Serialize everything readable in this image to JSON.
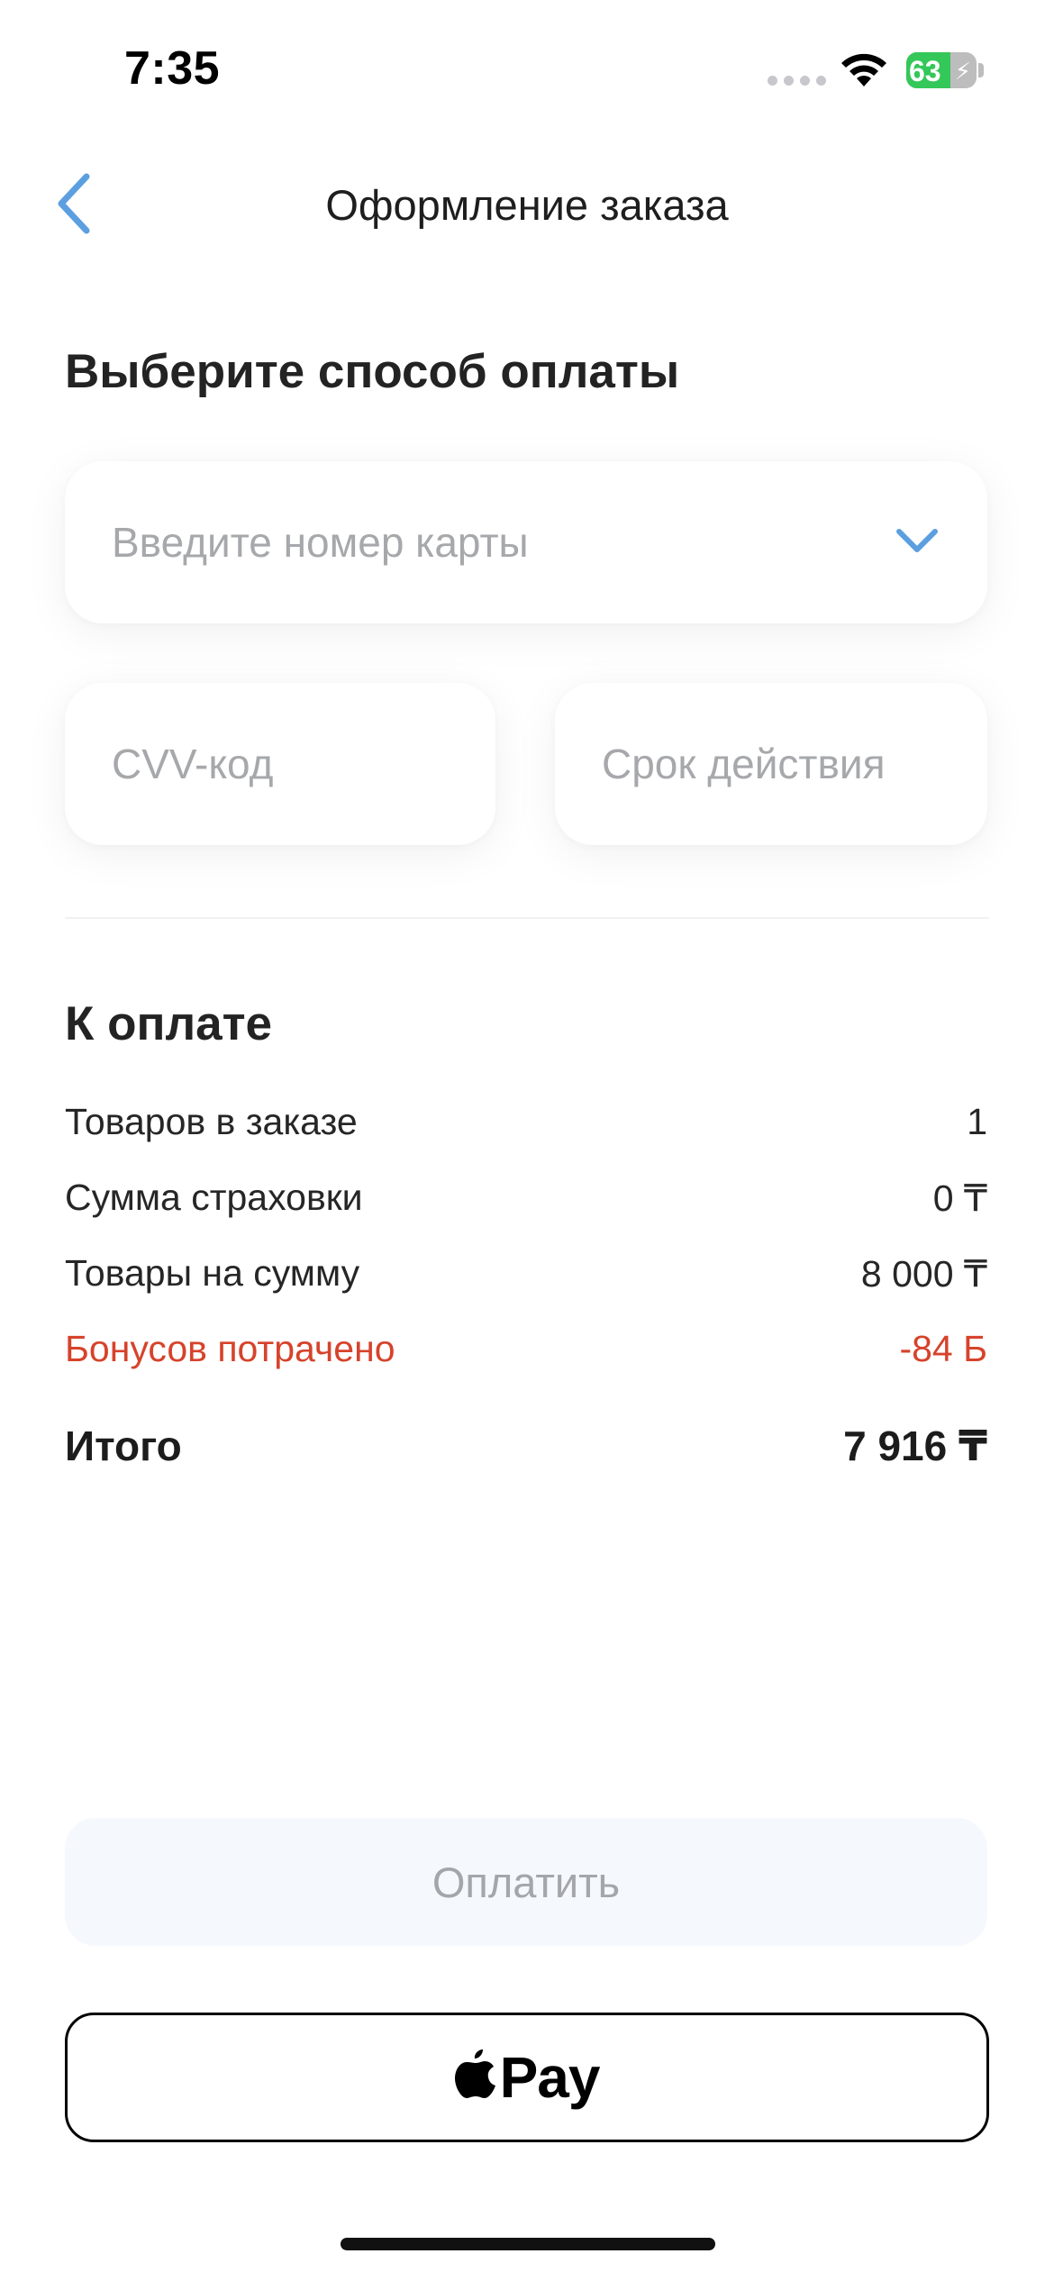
{
  "status_bar": {
    "time": "7:35",
    "battery_level": "63",
    "battery_fraction": 0.63,
    "battery_color": "#34c759"
  },
  "nav": {
    "title": "Оформление заказа",
    "back_icon": "chevron-left-icon",
    "accent_color": "#5b9fe0"
  },
  "payment": {
    "section_title": "Выберите способ оплаты",
    "card_placeholder": "Введите номер карты",
    "card_dropdown_icon": "chevron-down-icon",
    "cvv_placeholder": "CVV-код",
    "expiry_placeholder": "Срок действия"
  },
  "summary": {
    "section_title": "К оплате",
    "rows": [
      {
        "label": "Товаров в заказе",
        "value": "1"
      },
      {
        "label": "Сумма страховки",
        "value": "0 ₸"
      },
      {
        "label": "Товары на сумму",
        "value": "8 000 ₸"
      },
      {
        "label": "Бонусов потрачено",
        "value": "-84 Б",
        "color": "#d6432b"
      }
    ],
    "total_label": "Итого",
    "total_value": "7 916 ₸"
  },
  "actions": {
    "pay_label": "Оплатить",
    "apple_pay_label": "Pay",
    "apple_icon": "apple-logo-icon"
  }
}
